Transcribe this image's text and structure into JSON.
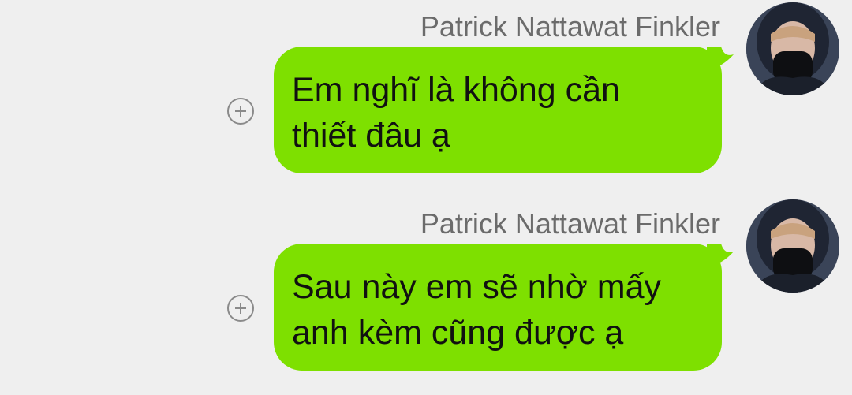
{
  "colors": {
    "background": "#efefef",
    "bubble": "#7ee000",
    "sender_text": "#6b6b6b",
    "message_text": "#111111"
  },
  "messages": [
    {
      "sender": "Patrick Nattawat Finkler",
      "text": "Em nghĩ là không cần\nthiết đâu ạ",
      "avatar_icon": "user-avatar-photo",
      "action_icon": "add-circle-icon"
    },
    {
      "sender": "Patrick Nattawat Finkler",
      "text": "Sau này em sẽ nhờ mấy\nanh kèm cũng được ạ",
      "avatar_icon": "user-avatar-photo",
      "action_icon": "add-circle-icon"
    }
  ]
}
